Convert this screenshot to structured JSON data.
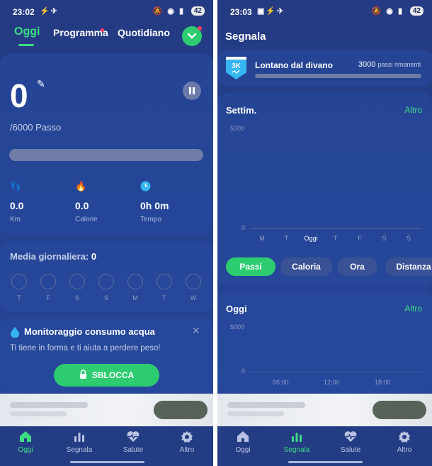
{
  "left": {
    "status": {
      "time": "23:02",
      "battery": "42"
    },
    "tabs": [
      {
        "label": "Oggi",
        "active": true
      },
      {
        "label": "Programma",
        "dot": true
      },
      {
        "label": "Quotidiano"
      }
    ],
    "steps": {
      "value": "0",
      "goal": "/6000 Passo",
      "progress": 0
    },
    "metrics": [
      {
        "icon": "footprints-icon",
        "value": "0.0",
        "label": "Km",
        "color": "#f1d23a"
      },
      {
        "icon": "flame-icon",
        "value": "0.0",
        "label": "Calorie",
        "color": "#f08a3c"
      },
      {
        "icon": "clock-icon",
        "value": "0h 0m",
        "label": "Tempo",
        "color": "#35b6f0"
      }
    ],
    "daily_average": {
      "label": "Media giornaliera:",
      "value": "0",
      "days": [
        "T",
        "F",
        "S",
        "S",
        "M",
        "T",
        "W"
      ]
    },
    "water_card": {
      "title": "Monitoraggio consumo acqua",
      "description": "Ti tiene in forma e ti aiuta a perdere peso!",
      "button": "SBLOCCA"
    }
  },
  "right": {
    "status": {
      "time": "23:03",
      "battery": "42"
    },
    "title": "Segnala",
    "challenge": {
      "badge": "3K",
      "name": "Lontano dal divano",
      "remaining_value": "3000",
      "remaining_label": "passi rimanenti",
      "progress": 0
    },
    "weekly": {
      "title": "Settim.",
      "more": "Altro",
      "y_max": "5000",
      "y_min": "0",
      "days": [
        "M",
        "T",
        "Oggi",
        "T",
        "F",
        "S",
        "S"
      ]
    },
    "chips": [
      {
        "label": "Passi",
        "active": true
      },
      {
        "label": "Caloria"
      },
      {
        "label": "Ora"
      },
      {
        "label": "Distanza"
      }
    ],
    "today": {
      "title": "Oggi",
      "more": "Altro",
      "y_max": "5000",
      "y_min": "0",
      "times": [
        "06:00",
        "12:00",
        "18:00"
      ]
    }
  },
  "nav": [
    {
      "icon": "home-icon",
      "label": "Oggi"
    },
    {
      "icon": "bar-chart-icon",
      "label": "Segnala"
    },
    {
      "icon": "heart-pulse-icon",
      "label": "Salute"
    },
    {
      "icon": "gear-icon",
      "label": "Altro"
    }
  ],
  "colors": {
    "accent": "#3ddc84",
    "background": "#243a82",
    "notification_dot": "#ff4060"
  }
}
